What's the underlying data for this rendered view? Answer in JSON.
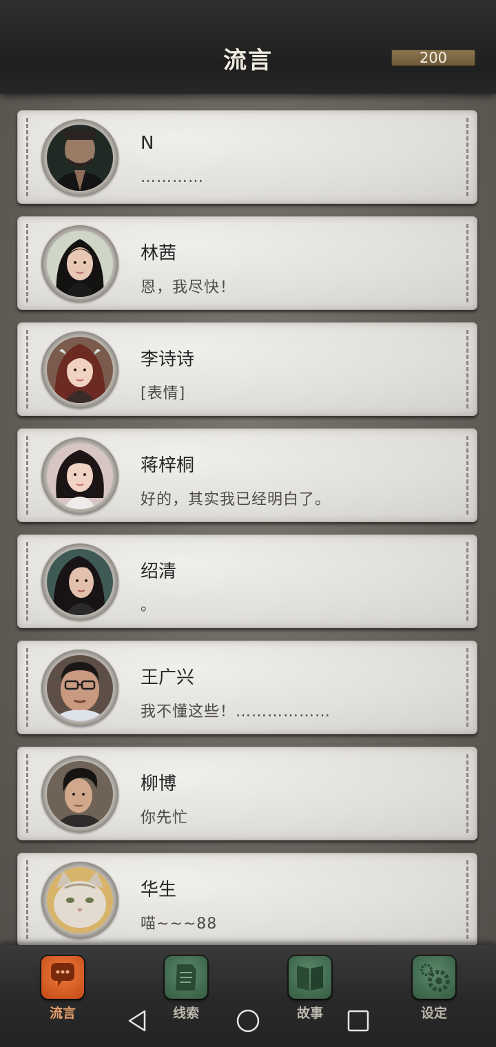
{
  "header": {
    "title": "流言",
    "currency": "200"
  },
  "contacts": [
    {
      "name": "N",
      "message": "…………",
      "avatar": "man-dark-avatar"
    },
    {
      "name": "林茜",
      "message": "恩，我尽快！",
      "avatar": "woman-avatar"
    },
    {
      "name": "李诗诗",
      "message": "[表情]",
      "avatar": "woman-avatar"
    },
    {
      "name": "蒋梓桐",
      "message": "好的，其实我已经明白了。",
      "avatar": "woman-avatar"
    },
    {
      "name": "绍清",
      "message": "。",
      "avatar": "woman-avatar"
    },
    {
      "name": "王广兴",
      "message": "我不懂这些！………………",
      "avatar": "man-glasses-avatar"
    },
    {
      "name": "柳博",
      "message": "你先忙",
      "avatar": "man-avatar"
    },
    {
      "name": "华生",
      "message": "喵~~~88",
      "avatar": "cat-avatar"
    }
  ],
  "nav": {
    "tabs": [
      {
        "label": "流言",
        "icon": "chat-bubble-icon",
        "active": true
      },
      {
        "label": "线索",
        "icon": "document-icon",
        "active": false
      },
      {
        "label": "故事",
        "icon": "book-icon",
        "active": false
      },
      {
        "label": "设定",
        "icon": "gear-icon",
        "active": false
      }
    ]
  },
  "system_nav": {
    "buttons": [
      "back-icon",
      "home-icon",
      "recents-icon"
    ]
  },
  "colors": {
    "active_tab": "#e8a06c",
    "active_icon": "#d2591f",
    "inactive_icon": "#3f6b4f"
  }
}
